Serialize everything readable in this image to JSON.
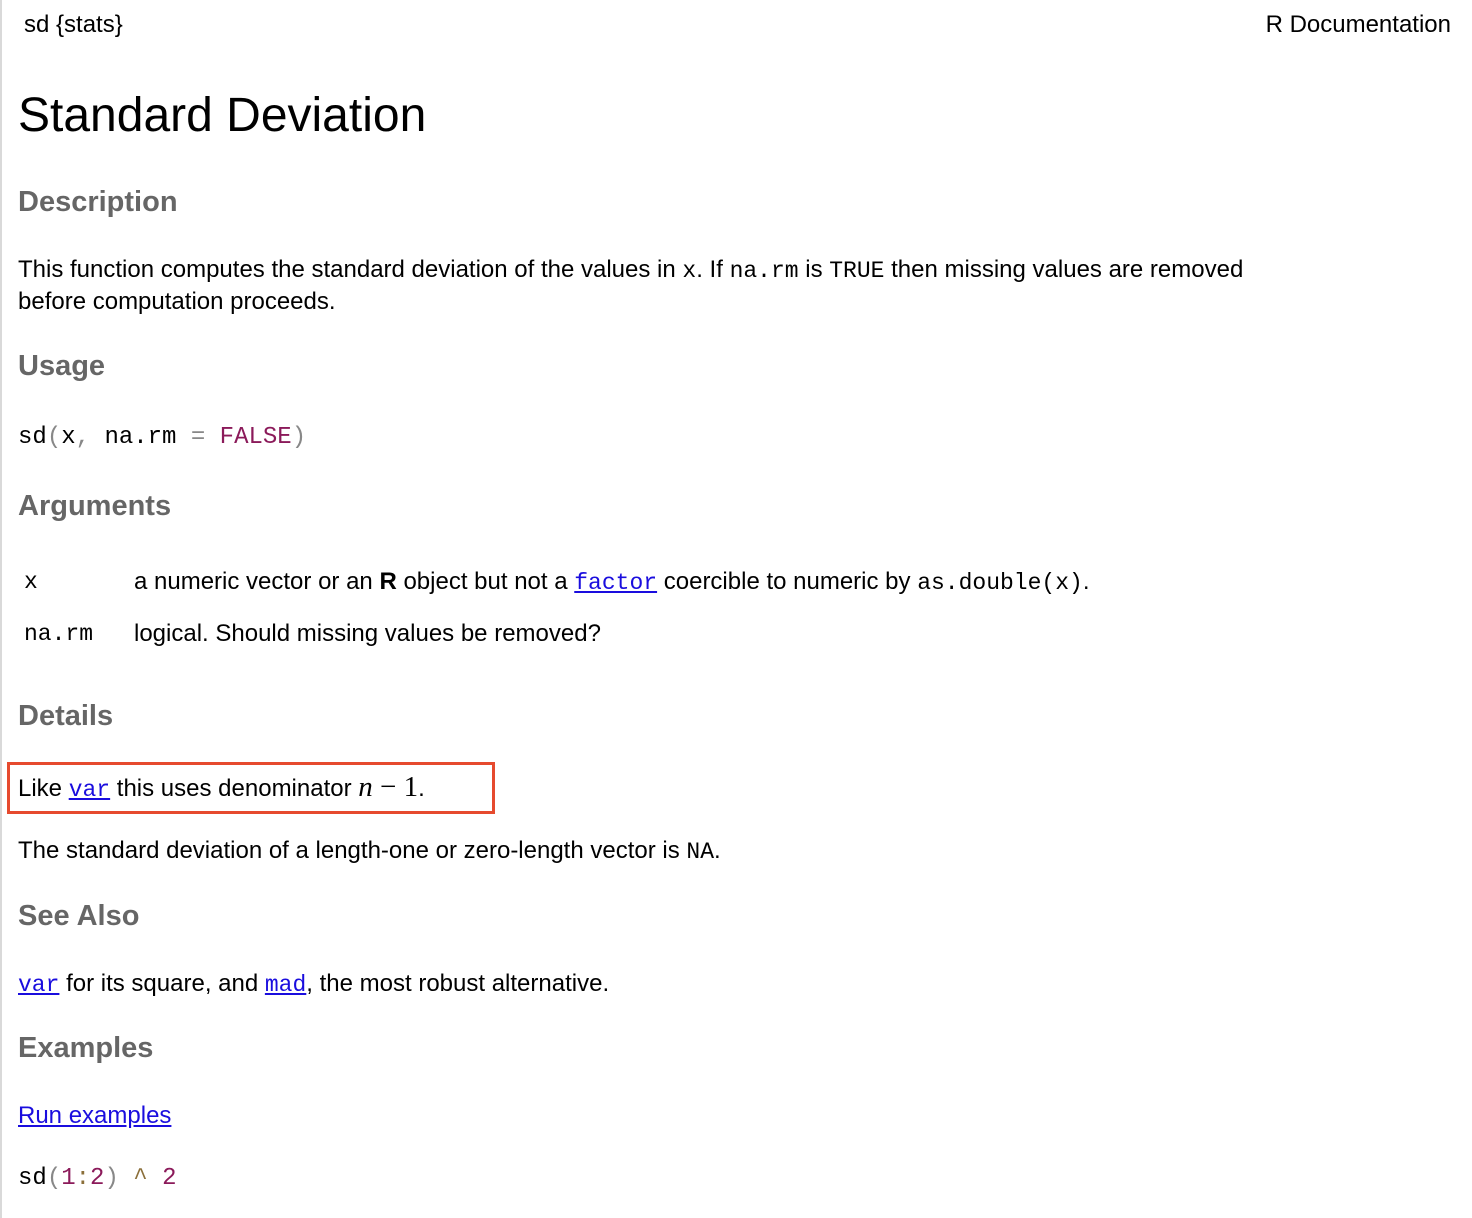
{
  "header": {
    "package_label": "sd {stats}",
    "doc_label": "R Documentation"
  },
  "title": "Standard Deviation",
  "description": {
    "heading": "Description",
    "t1": "This function computes the standard deviation of the values in ",
    "c1": "x",
    "t2": ". If ",
    "c2": "na.rm",
    "t3": " is ",
    "c3": "TRUE",
    "t4": " then missing values are removed",
    "line2": "before computation proceeds."
  },
  "usage": {
    "heading": "Usage",
    "fn": "sd",
    "open": "(",
    "arg1": "x",
    "comma": ",",
    "arg2": "na.rm",
    "eq": "=",
    "value": "FALSE",
    "close": ")"
  },
  "arguments": {
    "heading": "Arguments",
    "items": [
      {
        "name": "x",
        "t1": "a numeric vector or an ",
        "bold": "R",
        "t2": " object but not a ",
        "link": "factor",
        "t3": " coercible to numeric by ",
        "code": "as.double(x)",
        "t4": "."
      },
      {
        "name": "na.rm",
        "text": "logical. Should missing values be removed?"
      }
    ]
  },
  "details": {
    "heading": "Details",
    "like_prefix": "Like ",
    "like_link": "var",
    "like_mid": " this uses denominator ",
    "math_n": "n",
    "math_rest": " − 1",
    "like_end": ".",
    "p2_text": "The standard deviation of a length-one or zero-length vector is ",
    "p2_code": "NA",
    "p2_end": "."
  },
  "see_also": {
    "heading": "See Also",
    "link1": "var",
    "t1": " for its square, and ",
    "link2": "mad",
    "t2": ", the most robust alternative."
  },
  "examples": {
    "heading": "Examples",
    "run_link": "Run examples",
    "fn": "sd",
    "open": "(",
    "from": "1",
    "colon": ":",
    "to": "2",
    "close": ")",
    "caret": "^",
    "power": "2"
  },
  "colors": {
    "link": "#1a0dde",
    "heading": "#666666",
    "highlight_border": "#e64a2e",
    "constant": "#8b1a5a"
  }
}
